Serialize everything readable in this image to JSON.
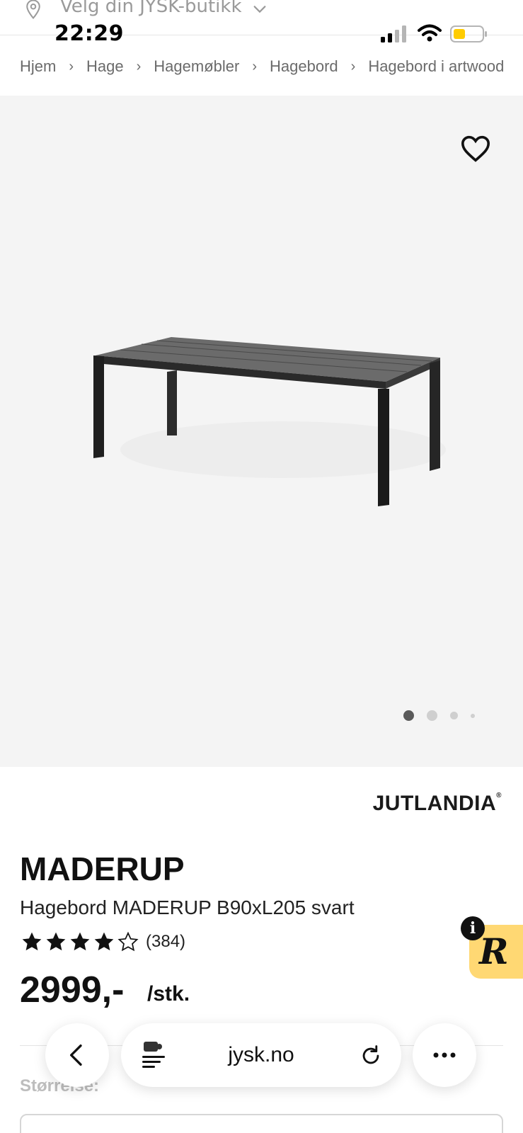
{
  "store_selector": {
    "label": "Velg din JYSK-butikk",
    "icon": "location-pin-icon"
  },
  "status_bar": {
    "time": "22:29"
  },
  "breadcrumb": [
    "Hjem",
    "Hage",
    "Hagemøbler",
    "Hagebord",
    "Hagebord i artwood"
  ],
  "gallery": {
    "image_count": 4,
    "active_index": 0
  },
  "product": {
    "brand": "JUTLANDIA",
    "brand_mark": "®",
    "name": "MADERUP",
    "description": "Hagebord MADERUP B90xL205 svart",
    "rating": 4,
    "rating_max": 5,
    "rating_count": "(384)",
    "price": "2999,-",
    "unit": "/stk."
  },
  "size": {
    "label": "Størrelse:"
  },
  "widget": {
    "letter": "R",
    "info": "i",
    "color": "#ffd873"
  },
  "browser": {
    "url": "jysk.no"
  }
}
